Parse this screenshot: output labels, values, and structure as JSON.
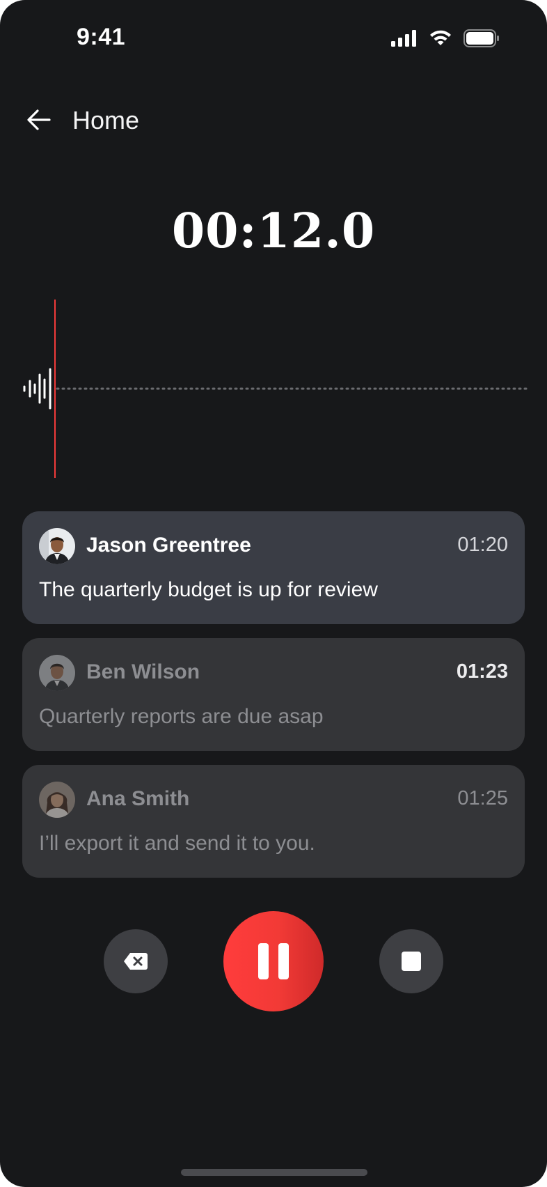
{
  "status_bar": {
    "time": "9:41",
    "icons": [
      "cellular-signal-icon",
      "wifi-icon",
      "battery-icon"
    ]
  },
  "header": {
    "back_icon": "arrow-left-icon",
    "title": "Home"
  },
  "recording": {
    "elapsed": "00:12.0"
  },
  "transcript": [
    {
      "speaker": "Jason Greentree",
      "timestamp": "01:20",
      "text": "The quarterly budget is up for review",
      "state": "active"
    },
    {
      "speaker": "Ben Wilson",
      "timestamp": "01:23",
      "text": "Quarterly reports are due asap",
      "state": "inactive"
    },
    {
      "speaker": "Ana Smith",
      "timestamp": "01:25",
      "text": "I’ll export it and send it to you.",
      "state": "inactive"
    }
  ],
  "controls": {
    "delete_icon": "backspace-icon",
    "pause_icon": "pause-icon",
    "stop_icon": "stop-icon"
  },
  "colors": {
    "background": "#17181a",
    "accent_red": "#f53b3b",
    "card_active": "#3a3d45",
    "card_inactive": "#343538"
  }
}
